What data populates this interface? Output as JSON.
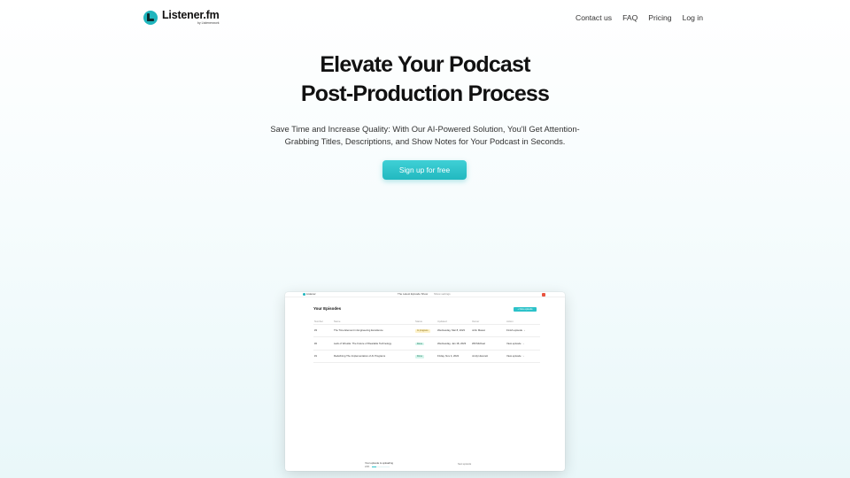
{
  "header": {
    "brand": "Listener.fm",
    "brand_sub": "by Listenerwork",
    "nav": [
      "Contact us",
      "FAQ",
      "Pricing",
      "Log in"
    ]
  },
  "hero": {
    "title_line1": "Elevate Your Podcast",
    "title_line2": "Post-Production Process",
    "subtitle": "Save Time and Increase Quality: With Our AI-Powered Solution, You'll Get Attention-Grabbing Titles, Descriptions, and Show Notes for Your Podcast in Seconds.",
    "cta": "Sign up for free"
  },
  "preview": {
    "brand": "Listener",
    "tab_active": "The Latest Episode Show",
    "tab_other": "Show settings",
    "heading": "Your Episodes",
    "new_button": "+ New episode",
    "columns": [
      "Number",
      "Name",
      "Status",
      "Updated",
      "Owner",
      "Action"
    ],
    "rows": [
      {
        "number": "#3",
        "name": "The Time Element in Engineering Excellence",
        "status": "In progress",
        "status_kind": "in-progress",
        "updated": "Wednesday, Mar 8, 2023",
        "owner": "John Mason",
        "action": "Finish episode"
      },
      {
        "number": "#2",
        "name": "Lack of Wrestle: The Future of Wearable Technology",
        "status": "Done",
        "status_kind": "done",
        "updated": "Wednesday, Jan 18, 2023",
        "owner": "Will Michael",
        "action": "View episode"
      },
      {
        "number": "#1",
        "name": "Redefining The Implementation of AI Programs",
        "status": "Done",
        "status_kind": "done",
        "updated": "Friday, Nov 4, 2022",
        "owner": "Jordyn Everett",
        "action": "View episode"
      }
    ],
    "upload_status": "Your episode is uploading",
    "upload_percent": "24%",
    "upload_fraction": 0.24,
    "footer_right": "Next episode"
  },
  "colors": {
    "accent": "#1fb5bd",
    "cta": "#2cc2c9"
  }
}
